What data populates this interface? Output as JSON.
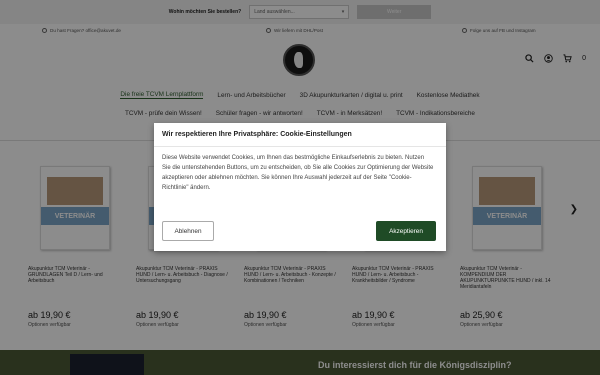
{
  "topbar": {
    "question": "Wohin möchten Sie bestellen?",
    "country_select": "Land auswählen...",
    "go_label": "Weiter"
  },
  "infobar": {
    "contact": "Du hast Fragen? office@akuvet.de",
    "shipping": "Wir liefern mit DHL/Post",
    "social": "Folge uns auf FB und Instagram"
  },
  "header": {
    "cart_count": "0",
    "brand_accent": "#2f5d2f"
  },
  "nav": {
    "row1": [
      "Die freie TCVM Lernplattform",
      "Lern- und Arbeitsbücher",
      "3D Akupunkturkarten / digital u. print",
      "Kostenlose Mediathek"
    ],
    "row2": [
      "TCVM - prüfe dein Wissen!",
      "Schüler fragen - wir antworten!",
      "TCVM - in Merksätzen!",
      "TCVM - Indikationsbereiche"
    ]
  },
  "products": [
    {
      "name": "Akupunktur TCM Veterinär - GRUNDLAGEN Teil D / Lern- und Arbeitsbuch",
      "price": "ab 19,90 €",
      "options": "Optionen verfügbar",
      "cover_title": "VETERINÄR"
    },
    {
      "name": "Akupunktur TCM Veterinär - PRAXIS HUND / Lern- u. Arbeitsbuch - Diagnose / Untersuchungsgang",
      "price": "ab 19,90 €",
      "options": "Optionen verfügbar",
      "cover_title": ""
    },
    {
      "name": "Akupunktur TCM Veterinär - PRAXIS HUND / Lern- u. Arbeitsbuch - Konzepte / Kombinationen / Techniken",
      "price": "ab 19,90 €",
      "options": "Optionen verfügbar",
      "cover_title": ""
    },
    {
      "name": "Akupunktur TCM Veterinär - PRAXIS HUND / Lern- u. Arbeitsbuch - Krankheitsbilder / Syndrome",
      "price": "ab 19,90 €",
      "options": "Optionen verfügbar",
      "cover_title": ""
    },
    {
      "name": "Akupunktur TCM Veterinär - KOMPENDIUM DER AKUPUNKTURPUNKTE HUND / inkl. 14 Meridiantafeln",
      "price": "ab 25,90 €",
      "options": "Optionen verfügbar",
      "cover_title": "VETERINÄR"
    }
  ],
  "bottom_banner": {
    "text": "Du interessierst dich für die Königsdisziplin?"
  },
  "cookie": {
    "title": "Wir respektieren Ihre Privatsphäre: Cookie-Einstellungen",
    "body": "Diese Website verwendet Cookies, um Ihnen das bestmögliche Einkaufserlebnis zu bieten. Nutzen Sie die untenstehenden Buttons, um zu entscheiden, ob Sie alle Cookies zur Optimierung der Website akzeptieren oder ablehnen möchten. Sie können Ihre Auswahl jederzeit auf der Seite \"Cookie-Richtlinie\" ändern.",
    "decline_label": "Ablehnen",
    "accept_label": "Akzeptieren",
    "accept_color": "#1f4b26"
  }
}
